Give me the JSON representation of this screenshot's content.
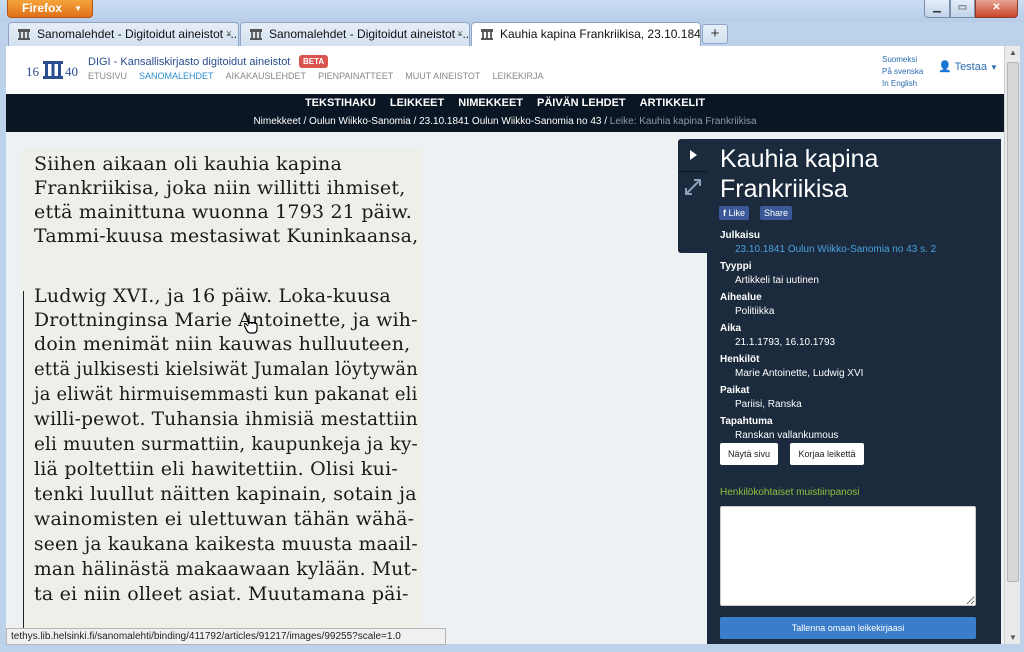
{
  "browser": {
    "menu_label": "Firefox",
    "tabs": [
      {
        "label": "Sanomalehdet - Digitoidut aineistot -..."
      },
      {
        "label": "Sanomalehdet - Digitoidut aineistot -..."
      },
      {
        "label": "Kauhia kapina Frankriikisa, 23.10.1841..."
      }
    ],
    "tab_close": "×",
    "new_tab": "+",
    "status_url": "tethys.lib.helsinki.fi/sanomalehti/binding/411792/articles/91217/images/99255?scale=1.0"
  },
  "site": {
    "title": "DIGI - Kansalliskirjasto digitoidut aineistot",
    "beta": "BETA",
    "nav": [
      "ETUSIVU",
      "SANOMALEHDET",
      "AIKAKAUSLEHDET",
      "PIENPAINATTEET",
      "MUUT AINEISTOT",
      "LEIKEKIRJA"
    ],
    "languages": [
      "Suomeksi",
      "På svenska",
      "In English"
    ],
    "user": "Testaa"
  },
  "navbar": {
    "items": [
      "TEKSTIHAKU",
      "LEIKKEET",
      "NIMEKKEET",
      "PÄIVÄN LEHDET",
      "ARTIKKELIT"
    ],
    "breadcrumb": [
      "Nimekkeet",
      "Oulun Wiikko-Sanomia",
      "23.10.1841 Oulun Wiikko-Sanomia no 43",
      "Leike: Kauhia kapina Frankriikisa"
    ]
  },
  "scan_lines": [
    "Siihen aikaan oli kauhia kapina",
    "Frankriikisa, joka niin willitti ihmiset,",
    "että mainittuna wuonna 1793 21 päiw.",
    "Tammi-kuusa mestasiwat Kuninkaansa,",
    "Ludwig XVI., ja 16 päiw. Loka-kuusa",
    "Drottninginsa Marie Antoinette, ja wih-",
    "doin menimät niin kauwas hulluuteen,",
    "että julkisesti kielsiwät Jumalan löytywän",
    "ja eliwät hirmuisemmasti kun pakanat eli",
    "willi-pewot. Tuhansia ihmisiä mestattiin",
    "eli muuten surmattiin, kaupunkeja ja ky-",
    "liä poltettiin eli hawitettiin. Olisi kui-",
    "tenki luullut näitten kapinain, sotain ja",
    "wainomisten ei ulettuwan tähän wähä-",
    "seen ja kaukana kaikesta muusta maail-",
    "man hälinästä makaawaan kylään. Mut-",
    "ta ei niin olleet asiat. Muutamana päi-"
  ],
  "article": {
    "title": "Kauhia kapina Frankriikisa",
    "like": "Like",
    "share": "Share",
    "fields": [
      {
        "label": "Julkaisu",
        "value": "23.10.1841 Oulun Wiikko-Sanomia no 43 s. 2",
        "link": true
      },
      {
        "label": "Tyyppi",
        "value": "Artikkeli tai uutinen"
      },
      {
        "label": "Aihealue",
        "value": "Politiikka"
      },
      {
        "label": "Aika",
        "value": "21.1.1793, 16.10.1793"
      },
      {
        "label": "Henkilöt",
        "value": "Marie Antoinette, Ludwig XVI"
      },
      {
        "label": "Paikat",
        "value": "Pariisi, Ranska"
      },
      {
        "label": "Tapahtuma",
        "value": "Ranskan vallankumous"
      }
    ],
    "show_page": "Näytä sivu",
    "fix_clip": "Korjaa leikettä",
    "notes_title": "Henkilökohtaiset muistiinpanosi",
    "notes_value": "",
    "save": "Tallenna omaan leikekirjaasi"
  },
  "colors": {
    "navbar": "#0b1624",
    "panel": "#1b2a3c",
    "link": "#4aa3df",
    "notes_title": "#8ac33e",
    "beta": "#d9534f",
    "save_button": "#3a7dc9"
  }
}
